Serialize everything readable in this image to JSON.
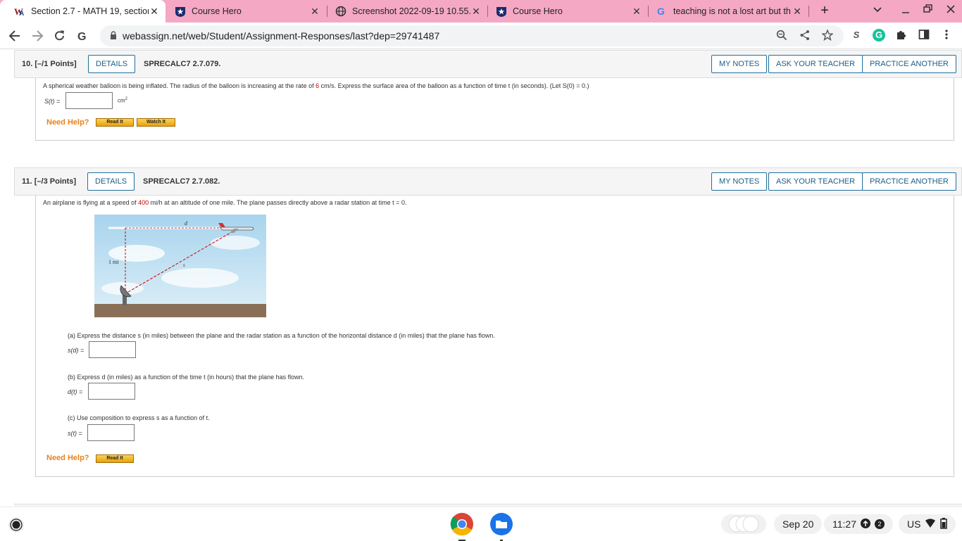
{
  "browser": {
    "tabs": [
      {
        "title": "Section 2.7 - MATH 19, section",
        "icon": "webassign-icon",
        "active": true
      },
      {
        "title": "Course Hero",
        "icon": "coursehero-icon",
        "active": false
      },
      {
        "title": "Screenshot 2022-09-19 10.55.",
        "icon": "globe-icon",
        "active": false
      },
      {
        "title": "Course Hero",
        "icon": "coursehero-icon",
        "active": false
      },
      {
        "title": "teaching is not a lost art but th",
        "icon": "google-icon",
        "active": false
      }
    ],
    "new_tab": "+",
    "url": "webassign.net/web/Student/Assignment-Responses/last?dep=29741487",
    "accent": "#f4a8c4"
  },
  "questions": [
    {
      "number": "10.",
      "points": "[–/1 Points]",
      "details_label": "DETAILS",
      "code": "SPRECALC7 2.7.079.",
      "my_notes_label": "MY NOTES",
      "ask_teacher_label": "ASK YOUR TEACHER",
      "practice_label": "PRACTICE ANOTHER",
      "text_before": "A spherical weather balloon is being inflated. The radius of the balloon is increasing at the rate of",
      "rate_value": "6",
      "text_after": "cm/s. Express the surface area of the balloon as a function of time t (in seconds). (Let S(0) = 0.)",
      "answer_label": "S(t) =",
      "unit": "cm",
      "unit_exp": "2",
      "need_help": "Need Help?",
      "read_it": "Read It",
      "watch_it": "Watch It"
    },
    {
      "number": "11.",
      "points": "[–/3 Points]",
      "details_label": "DETAILS",
      "code": "SPRECALC7 2.7.082.",
      "my_notes_label": "MY NOTES",
      "ask_teacher_label": "ASK YOUR TEACHER",
      "practice_label": "PRACTICE ANOTHER",
      "text_before": "An airplane is flying at a speed of",
      "speed_value": "400",
      "text_after": "mi/h at an altitude of one mile. The plane passes directly above a radar station at time  t = 0.",
      "figure": {
        "d_label": "d",
        "s_label": "s",
        "alt_label": "1 mi"
      },
      "part_a": "(a) Express the distance s (in miles) between the plane and the radar station as a function of the horizontal distance d (in miles) that the plane has flown.",
      "part_a_label": "s(d) =",
      "part_b": "(b) Express d (in miles) as a function of the time t (in hours) that the plane has flown.",
      "part_b_label": "d(t) =",
      "part_c": "(c) Use composition to express s as a function of t.",
      "part_c_label": "s(t) =",
      "need_help": "Need Help?",
      "read_it": "Read It"
    }
  ],
  "shelf": {
    "date": "Sep 20",
    "time": "11:27",
    "notifications": "2",
    "locale": "US"
  }
}
